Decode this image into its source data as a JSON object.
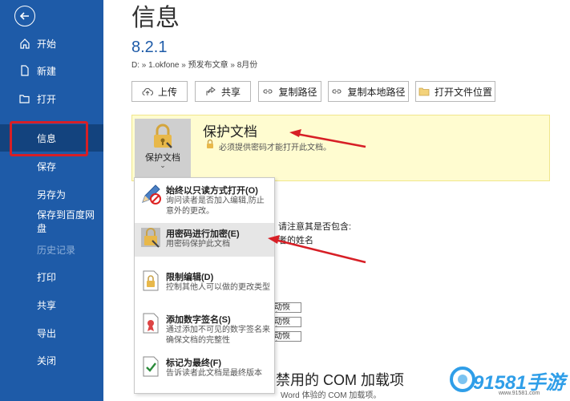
{
  "sidebar": {
    "items": [
      {
        "label": "开始",
        "icon": "home-icon"
      },
      {
        "label": "新建",
        "icon": "new-file-icon"
      },
      {
        "label": "打开",
        "icon": "folder-open-icon"
      },
      {
        "label": "信息"
      },
      {
        "label": "保存"
      },
      {
        "label": "另存为"
      },
      {
        "label": "保存到百度网盘"
      },
      {
        "label": "历史记录"
      },
      {
        "label": "打印"
      },
      {
        "label": "共享"
      },
      {
        "label": "导出"
      },
      {
        "label": "关闭"
      }
    ],
    "active": "信息",
    "background": "#1e5ba8"
  },
  "main": {
    "title": "信息",
    "doc_name": "8.2.1",
    "doc_path": "D: » 1.okfone » 预发布文章 » 8月份",
    "toolbar": [
      "上传",
      "共享",
      "复制路径",
      "复制本地路径",
      "打开文件位置"
    ]
  },
  "protect": {
    "tile_label": "保护文档",
    "tile_caret": "⌄",
    "title": "保护文档",
    "description": "必须提供密码才能打开此文档。",
    "panel_color": "#fffcd0"
  },
  "menu": {
    "items": [
      {
        "title": "始终以只读方式打开(O)",
        "desc": "询问读者是否加入编辑,防止意外的更改。",
        "icon": "pencil-readonly-icon"
      },
      {
        "title": "用密码进行加密(E)",
        "desc": "用密码保护此文档",
        "icon": "key-lock-icon"
      },
      {
        "title": "限制编辑(D)",
        "desc": "控制其他人可以做的更改类型",
        "icon": "restrict-editing-icon"
      },
      {
        "title": "添加数字签名(S)",
        "desc": "通过添加不可见的数字签名来确保文档的完整性",
        "icon": "digital-signature-icon"
      },
      {
        "title": "标记为最终(F)",
        "desc": "告诉读者此文档是最终版本",
        "icon": "mark-final-icon"
      }
    ]
  },
  "background": {
    "inspect_label": "请注意其是否包含:",
    "author_label": "者的姓名",
    "recover_buttons": [
      "动恢复)",
      "动恢复)",
      "动恢复)"
    ],
    "com_title": "禁用的 COM 加载项",
    "com_desc": "Word 体验的 COM 加载项。"
  },
  "watermark": {
    "text": "91581手游",
    "url": "www.91581.com"
  }
}
